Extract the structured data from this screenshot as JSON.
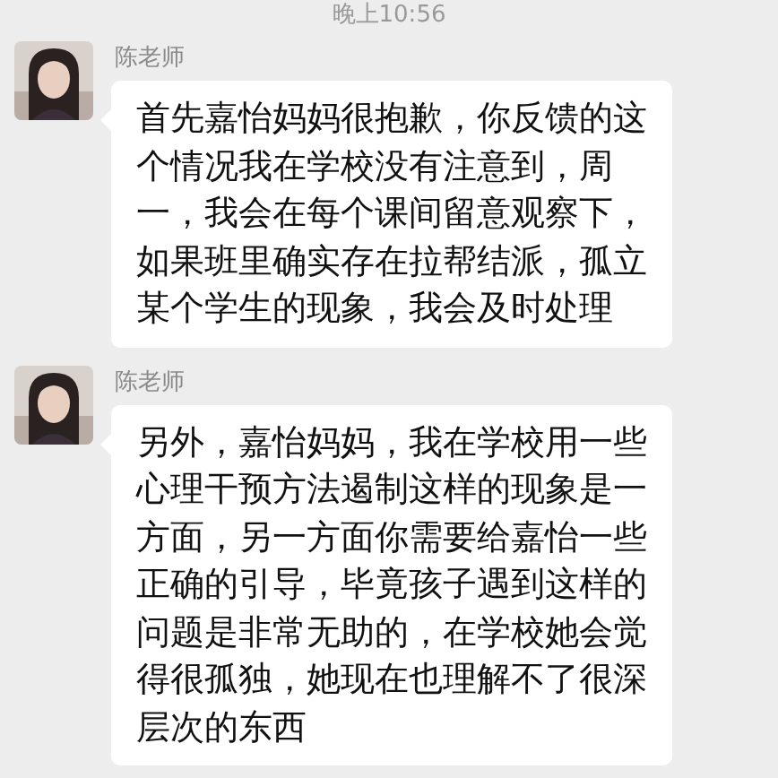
{
  "timestamp": "晚上10:56",
  "messages": [
    {
      "sender": "陈老师",
      "text": "首先嘉怡妈妈很抱歉，你反馈的这个情况我在学校没有注意到，周一，我会在每个课间留意观察下，如果班里确实存在拉帮结派，孤立某个学生的现象，我会及时处理"
    },
    {
      "sender": "陈老师",
      "text": "另外，嘉怡妈妈，我在学校用一些心理干预方法遏制这样的现象是一方面，另一方面你需要给嘉怡一些正确的引导，毕竟孩子遇到这样的问题是非常无助的，在学校她会觉得很孤独，她现在也理解不了很深层次的东西"
    }
  ]
}
